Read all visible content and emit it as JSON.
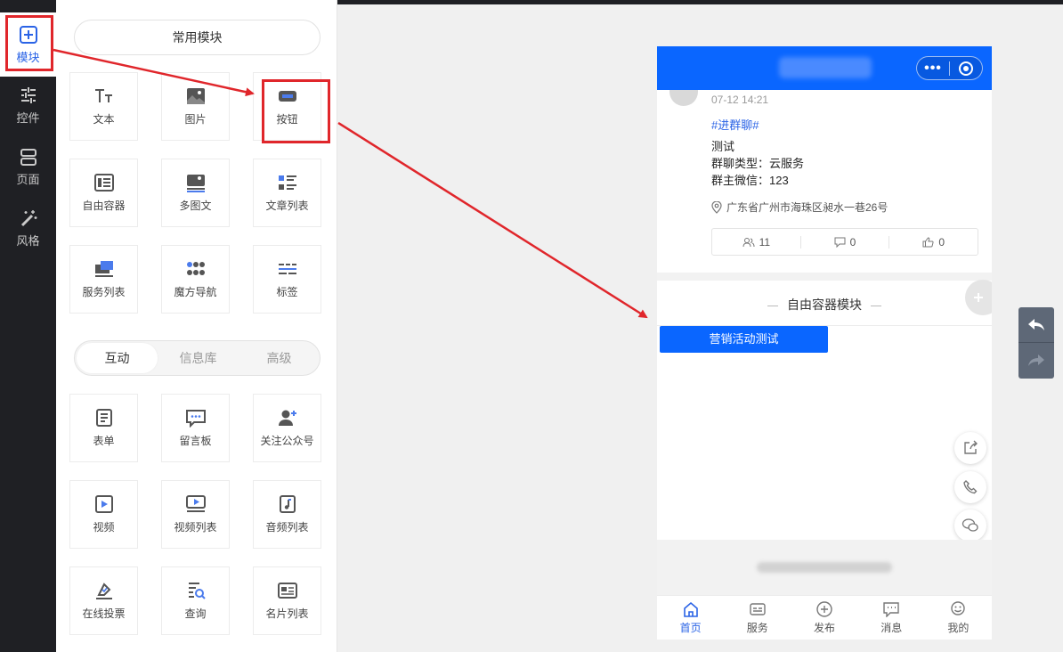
{
  "rail": {
    "items": [
      {
        "label": "模块"
      },
      {
        "label": "控件"
      },
      {
        "label": "页面"
      },
      {
        "label": "风格"
      }
    ]
  },
  "panel": {
    "common_title": "常用模块",
    "common_tiles": [
      "文本",
      "图片",
      "按钮",
      "自由容器",
      "多图文",
      "文章列表",
      "服务列表",
      "魔方导航",
      "标签"
    ],
    "tabs": [
      "互动",
      "信息库",
      "高级"
    ],
    "interact_tiles": [
      "表单",
      "留言板",
      "关注公众号",
      "视频",
      "视频列表",
      "音频列表",
      "在线投票",
      "查询",
      "名片列表"
    ]
  },
  "phone": {
    "post": {
      "time": "07-12 14:21",
      "tag": "#进群聊#",
      "lines": [
        "测试",
        "群聊类型：云服务",
        "群主微信：123"
      ],
      "location": "广东省广州市海珠区昶水一巷26号",
      "stats": {
        "members": "11",
        "comments": "0",
        "likes": "0"
      }
    },
    "container_title": "自由容器模块",
    "cta_label": "营销活动测试",
    "tabbar": [
      "首页",
      "服务",
      "发布",
      "消息",
      "我的"
    ]
  },
  "colors": {
    "accent": "#0a66ff",
    "highlight": "#e0262b",
    "rail": "#1f2024"
  }
}
